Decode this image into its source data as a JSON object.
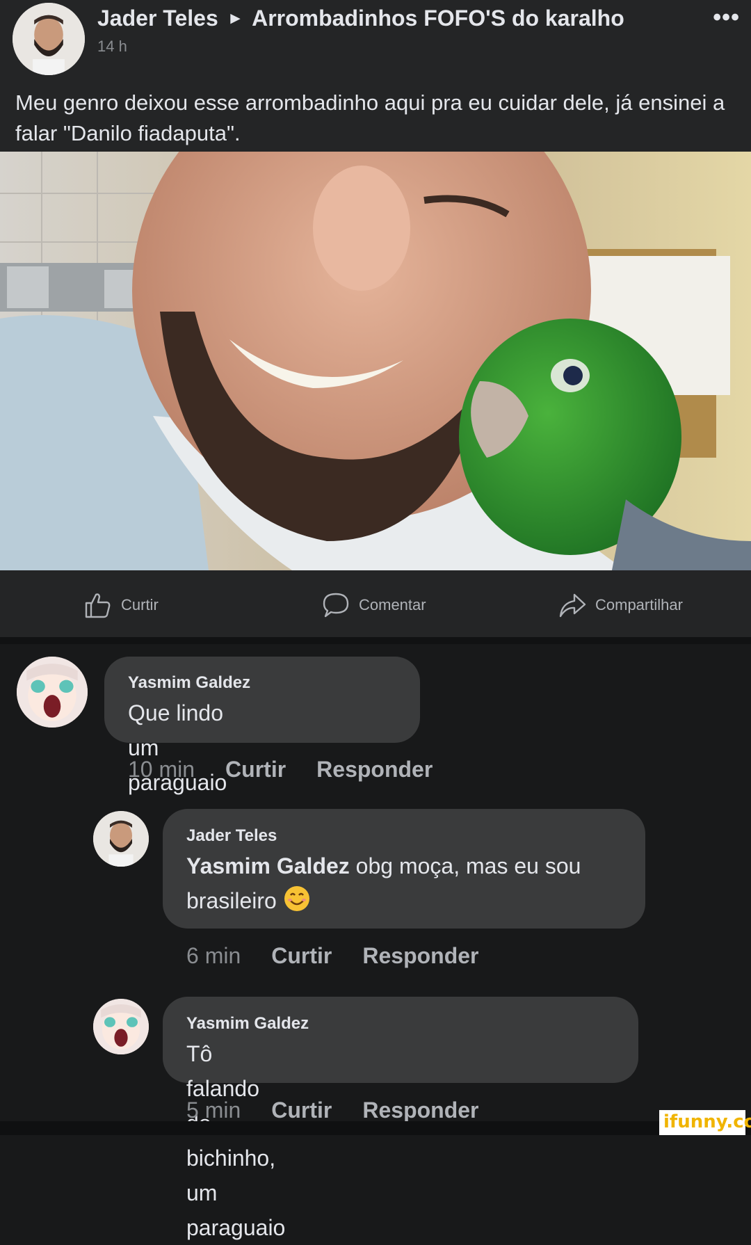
{
  "post": {
    "author": "Jader Teles",
    "group": "Arrombadinhos FOFO'S do karalho",
    "time": "14 h",
    "more_label": "•••",
    "text": "Meu genro deixou esse arrombadinho aqui pra eu cuidar dele, já ensinei a falar \"Danilo fiadaputa\"."
  },
  "actions": {
    "like": "Curtir",
    "comment": "Comentar",
    "share": "Compartilhar"
  },
  "comments": [
    {
      "name": "Yasmim Galdez",
      "text": "Que lindo um paraguaio",
      "time": "10 min",
      "like": "Curtir",
      "reply": "Responder"
    },
    {
      "name": "Jader Teles",
      "mention": "Yasmim Galdez",
      "text": " obg moça, mas eu sou brasileiro",
      "emoji": "smiling-face-emoji",
      "time": "6 min",
      "like": "Curtir",
      "reply": "Responder"
    },
    {
      "name": "Yasmim Galdez",
      "text": "Tô falando do bichinho, um paraguaio",
      "time": "5 min",
      "like": "Curtir",
      "reply": "Responder"
    }
  ],
  "watermark": "ifunny.co",
  "colors": {
    "background": "#18191a",
    "card": "#242526",
    "bubble": "#3a3b3c",
    "text": "#e4e6eb",
    "secondary": "#b0b3b8",
    "watermark": "#f0b400"
  }
}
